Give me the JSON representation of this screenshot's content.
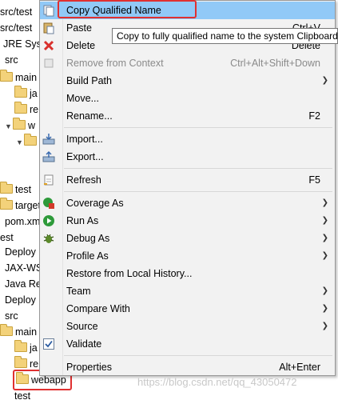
{
  "tree": {
    "rows": [
      {
        "text": "src/test",
        "indent": 0,
        "icon": "folder"
      },
      {
        "text": "src/test",
        "indent": 0,
        "icon": "folder"
      },
      {
        "text": "JRE Sys",
        "indent": 0,
        "icon": "library"
      },
      {
        "text": "src",
        "indent": 0,
        "icon": "folder"
      },
      {
        "text": "main",
        "indent": 1,
        "icon": "folder"
      },
      {
        "text": "ja",
        "indent": 2,
        "icon": "folder"
      },
      {
        "text": "re",
        "indent": 2,
        "icon": "folder"
      },
      {
        "text": "w",
        "indent": 1,
        "icon": "folder"
      },
      {
        "text": "",
        "indent": 2,
        "icon": "folder"
      },
      {
        "text": "",
        "indent": 0,
        "icon": ""
      },
      {
        "text": "",
        "indent": 0,
        "icon": ""
      },
      {
        "text": "test",
        "indent": 1,
        "icon": "folder"
      },
      {
        "text": "target",
        "indent": 0,
        "icon": "folder"
      },
      {
        "text": "pom.xm",
        "indent": 1,
        "icon": "file"
      },
      {
        "text": "est",
        "indent": 0,
        "icon": ""
      },
      {
        "text": "Deploy",
        "indent": 0,
        "icon": "deploy"
      },
      {
        "text": "JAX-WS",
        "indent": 1,
        "icon": "jax"
      },
      {
        "text": "Java Re",
        "indent": 0,
        "icon": "library"
      },
      {
        "text": "Deploy",
        "indent": 0,
        "icon": "deploy"
      },
      {
        "text": "src",
        "indent": 0,
        "icon": "folder"
      },
      {
        "text": "main",
        "indent": 1,
        "icon": "folder"
      },
      {
        "text": "ja",
        "indent": 2,
        "icon": "folder"
      },
      {
        "text": "re",
        "indent": 2,
        "icon": "folder"
      },
      {
        "text": "webapp",
        "indent": 1,
        "icon": "folder"
      },
      {
        "text": "test",
        "indent": 1,
        "icon": "folder"
      }
    ]
  },
  "menu": {
    "copy_qualified_name": "Copy Qualified Name",
    "paste": "Paste",
    "paste_accel": "Ctrl+V",
    "delete": "Delete",
    "delete_accel": "Delete",
    "remove_from_context": "Remove from Context",
    "remove_from_context_accel": "Ctrl+Alt+Shift+Down",
    "build_path": "Build Path",
    "move": "Move...",
    "rename": "Rename...",
    "rename_accel": "F2",
    "import": "Import...",
    "export": "Export...",
    "refresh": "Refresh",
    "refresh_accel": "F5",
    "coverage_as": "Coverage As",
    "run_as": "Run As",
    "debug_as": "Debug As",
    "profile_as": "Profile As",
    "restore_local_history": "Restore from Local History...",
    "team": "Team",
    "compare_with": "Compare With",
    "source": "Source",
    "validate": "Validate",
    "properties": "Properties",
    "properties_accel": "Alt+Enter"
  },
  "tooltip": "Copy to fully qualified name to the system Clipboard",
  "watermark": "https://blog.csdn.net/qq_43050472",
  "colors": {
    "selection": "#91c9f7",
    "highlight_box": "#e03030",
    "menu_bg": "#f2f2f2"
  }
}
